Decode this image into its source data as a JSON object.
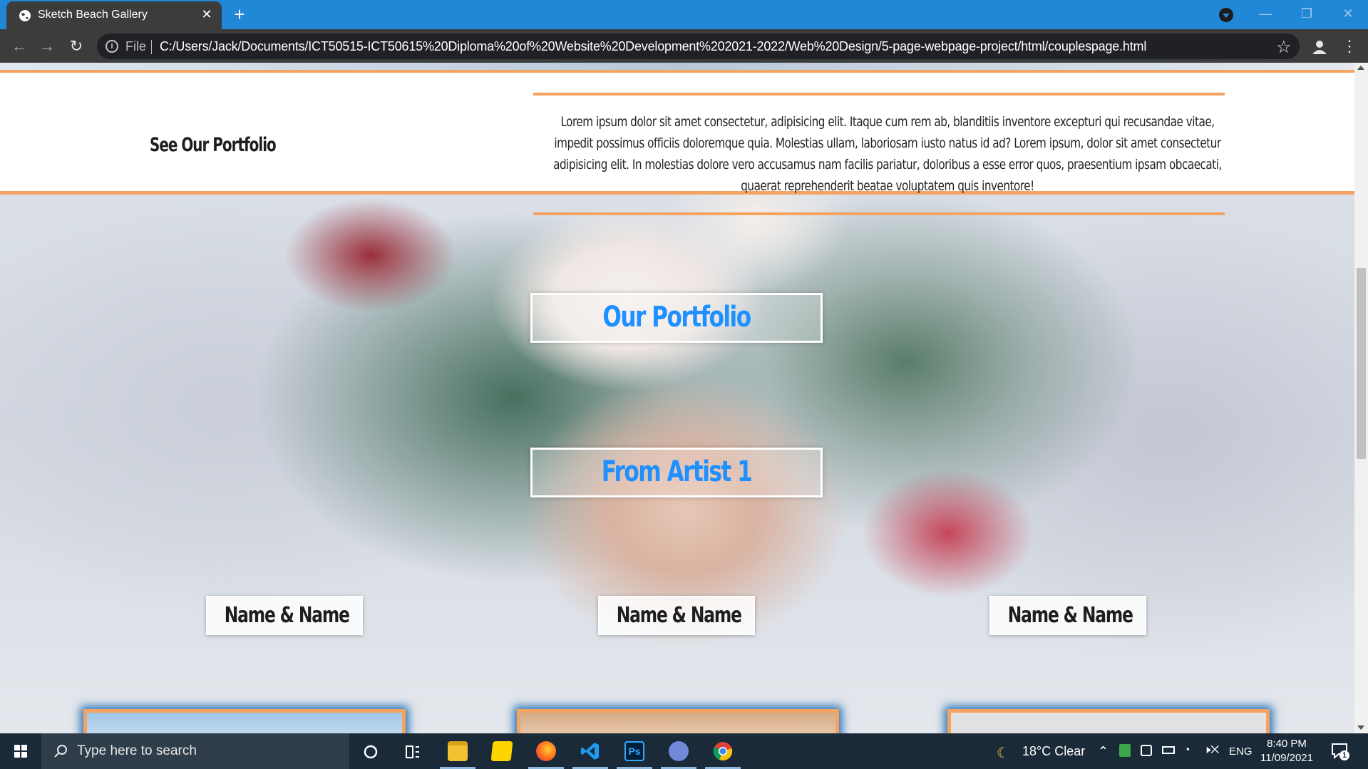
{
  "browser": {
    "tab_title": "Sketch Beach Gallery",
    "new_tab_symbol": "+",
    "file_label": "File",
    "url": "C:/Users/Jack/Documents/ICT50515-ICT50615%20Diploma%20of%20Website%20Development%202021-2022/Web%20Design/5-page-webpage-project/html/couplespage.html"
  },
  "page": {
    "intro_heading": "See Our Portfolio",
    "intro_text": "Lorem ipsum dolor sit amet consectetur, adipisicing elit. Itaque cum rem ab, blanditiis inventore excepturi qui recusandae vitae, impedit possimus officiis doloremque quia. Molestias ullam, laboriosam iusto natus id ad? Lorem ipsum, dolor sit amet consectetur adipisicing elit. In molestias dolore vero accusamus nam facilis pariatur, doloribus a esse error quos, praesentium ipsam obcaecati, quaerat reprehenderit beatae voluptatem quis inventore!",
    "portfolio_heading": "Our Portfolio",
    "artist_heading": "From Artist 1",
    "couples": [
      {
        "name": "Name & Name"
      },
      {
        "name": "Name & Name"
      },
      {
        "name": "Name & Name"
      }
    ]
  },
  "taskbar": {
    "search_placeholder": "Type here to search",
    "weather": "18°C  Clear",
    "language": "ENG",
    "time": "8:40 PM",
    "date": "11/09/2021",
    "notification_count": "1"
  },
  "colors": {
    "accent_orange": "#f4a460",
    "heading_blue": "#1e90ff",
    "tabstrip_blue": "#2188d8",
    "chrome_dark": "#3c3c3c",
    "taskbar": "#1b2a38"
  },
  "icons": [
    "globe-favicon-icon",
    "close-icon",
    "back-arrow-icon",
    "forward-arrow-icon",
    "reload-icon",
    "info-icon",
    "star-icon",
    "account-icon",
    "kebab-menu-icon",
    "windows-logo-icon",
    "search-icon",
    "cortana-icon",
    "task-view-icon",
    "file-explorer-icon",
    "sticky-notes-icon",
    "firefox-icon",
    "vscode-icon",
    "photoshop-icon",
    "discord-icon",
    "chrome-icon",
    "moon-weather-icon",
    "chevron-up-icon",
    "network-icon",
    "battery-icon",
    "volume-muted-icon",
    "notification-icon"
  ]
}
